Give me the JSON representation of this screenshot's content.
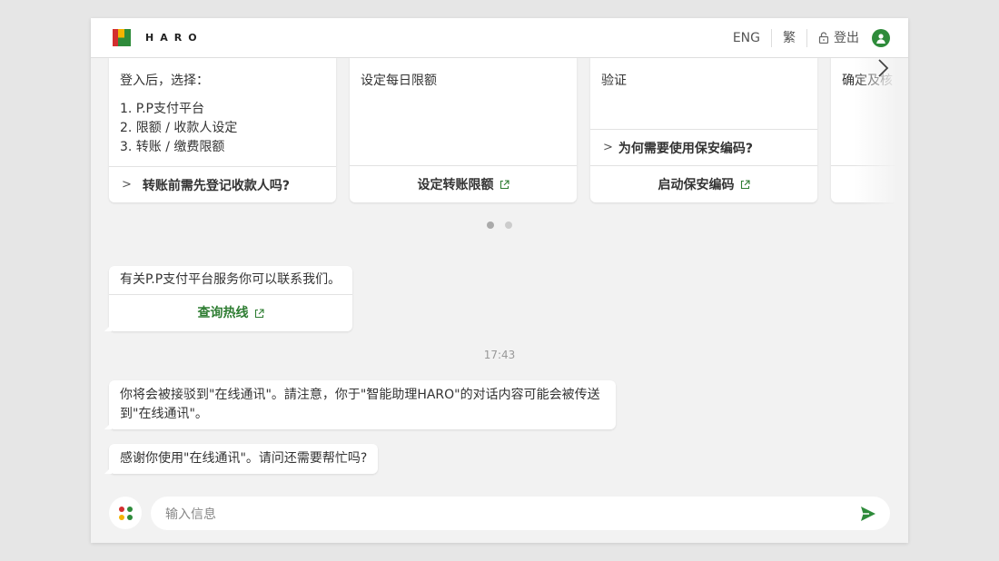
{
  "header": {
    "logo_text": "HARO",
    "lang_eng": "ENG",
    "lang_trad": "繁",
    "logout": "登出"
  },
  "cards": [
    {
      "title": "登入后，选择：",
      "steps": [
        "1. P.P支付平台",
        "2. 限额 / 收款人设定",
        "3. 转账 / 缴费限额"
      ],
      "link": "转账前需先登记收款人吗?"
    },
    {
      "title": "设定每日限额",
      "link": "设定转账限额"
    },
    {
      "title": "验证",
      "question": "为何需要使用保安编码?",
      "link": "启动保安编码"
    },
    {
      "title": "确定及核"
    }
  ],
  "messages": {
    "contact": "有关P.P支付平台服务你可以联系我们。",
    "hotline_link": "查询热线",
    "timestamp": "17:43",
    "transfer_notice": "你将会被接驳到\"在线通讯\"。請注意，你于\"智能助理HARO\"的对话内容可能会被传送到\"在线通讯\"。",
    "thanks": "感谢你使用\"在线通讯\"。请问还需要帮忙吗?"
  },
  "input": {
    "placeholder": "输入信息"
  },
  "colors": {
    "accent_green": "#2e7d32",
    "logo_red": "#d32f2f",
    "logo_green": "#2e8b3a",
    "logo_yellow": "#f4b400"
  }
}
